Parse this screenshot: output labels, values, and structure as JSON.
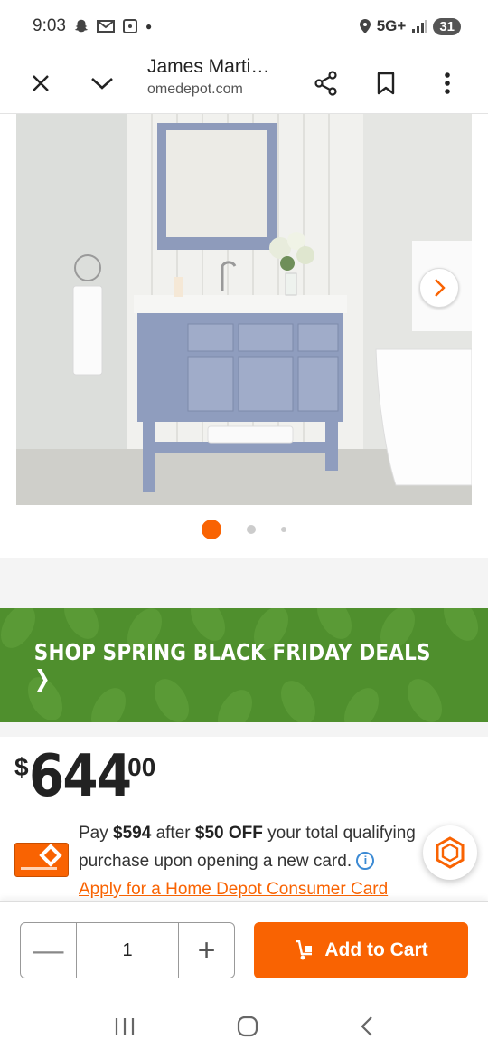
{
  "status": {
    "time": "9:03",
    "network": "5G+",
    "battery": "31"
  },
  "toolbar": {
    "title": "James Marti…",
    "domain": "omedepot.com"
  },
  "gallery": {
    "dots_total": 3,
    "active_index": 0
  },
  "promo": {
    "text": "SHOP SPRING BLACK FRIDAY DEALS ❯"
  },
  "price": {
    "currency": "$",
    "dollars": "644",
    "cents": "00"
  },
  "offer": {
    "pay_prefix": "Pay ",
    "pay_amount": "$594",
    "after": " after ",
    "discount": "$50 OFF",
    "rest": " your total qualifying purchase upon opening a new card. ",
    "info_glyph": "i",
    "apply_link": "Apply for a Home Depot Consumer Card"
  },
  "cart": {
    "quantity": "1",
    "minus": "—",
    "plus": "+",
    "add_label": "Add to Cart"
  },
  "colors": {
    "brand_orange": "#f96302",
    "promo_green": "#4f8f2d",
    "info_blue": "#3b8ad4"
  }
}
